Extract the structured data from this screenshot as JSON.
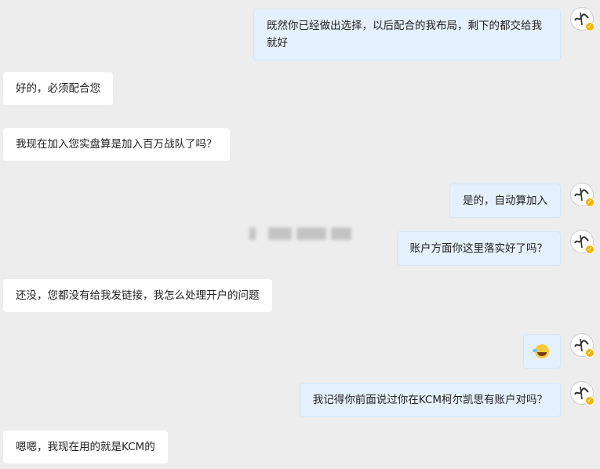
{
  "conversation": {
    "messages": [
      {
        "side": "right",
        "text": "既然你已经做出选择，以后配合的我布局，剩下的都交给我就好"
      },
      {
        "side": "left",
        "text": "好的，必须配合您"
      },
      {
        "side": "left",
        "text": "我现在加入您实盘算是加入百万战队了吗？"
      },
      {
        "side": "right",
        "text": "是的，自动算加入"
      },
      {
        "side": "right",
        "text": "账户方面你这里落实好了吗？"
      },
      {
        "side": "left",
        "text": "还没，您都没有给我发链接，我怎么处理开户的问题"
      },
      {
        "side": "right",
        "emoji": "laughing-crying-emoji"
      },
      {
        "side": "right",
        "text": "我记得你前面说过你在KCM柯尔凯思有账户对吗？"
      },
      {
        "side": "left",
        "text": "嗯嗯，我现在用的就是KCM的"
      }
    ]
  },
  "colors": {
    "background": "#ededed",
    "left_bubble": "#ffffff",
    "right_bubble": "#e4f0fb",
    "avatar_badge": "#f4b400"
  }
}
